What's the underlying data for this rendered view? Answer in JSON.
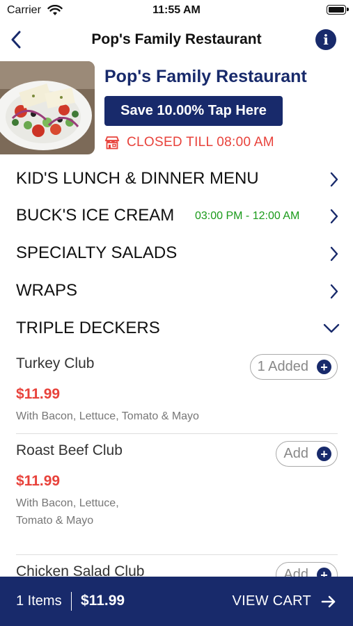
{
  "status_bar": {
    "carrier": "Carrier",
    "time": "11:55 AM"
  },
  "nav": {
    "title": "Pop's Family Restaurant"
  },
  "restaurant": {
    "name": "Pop's Family Restaurant",
    "promo_label": "Save 10.00% Tap Here",
    "status_text": "CLOSED TILL 08:00 AM"
  },
  "categories": [
    {
      "label": "KID'S LUNCH & DINNER MENU",
      "hours": "",
      "expanded": false
    },
    {
      "label": "BUCK'S ICE CREAM",
      "hours": "03:00 PM - 12:00 AM",
      "expanded": false
    },
    {
      "label": "SPECIALTY SALADS",
      "hours": "",
      "expanded": false
    },
    {
      "label": "WRAPS",
      "hours": "",
      "expanded": false
    },
    {
      "label": "TRIPLE DECKERS",
      "hours": "",
      "expanded": true
    }
  ],
  "items": [
    {
      "name": "Turkey Club",
      "price": "$11.99",
      "description": "With Bacon, Lettuce, Tomato & Mayo",
      "button_label": "1 Added"
    },
    {
      "name": "Roast Beef Club",
      "price": "$11.99",
      "description_line1": "With Bacon, Lettuce,",
      "description_line2": "Tomato & Mayo",
      "button_label": "Add"
    },
    {
      "name": "Chicken Salad Club",
      "button_label": "Add"
    }
  ],
  "cart": {
    "count_label": "1 Items",
    "total": "$11.99",
    "view_label": "VIEW CART"
  },
  "colors": {
    "brand": "#182a6b",
    "price": "#e8423b",
    "closed": "#e8423b",
    "hours": "#1a9a1a"
  },
  "icons": [
    "wifi-icon",
    "battery-icon",
    "back-chevron-icon",
    "info-icon",
    "store-icon",
    "chevron-right-icon",
    "chevron-down-icon",
    "plus-icon",
    "arrow-right-icon"
  ]
}
